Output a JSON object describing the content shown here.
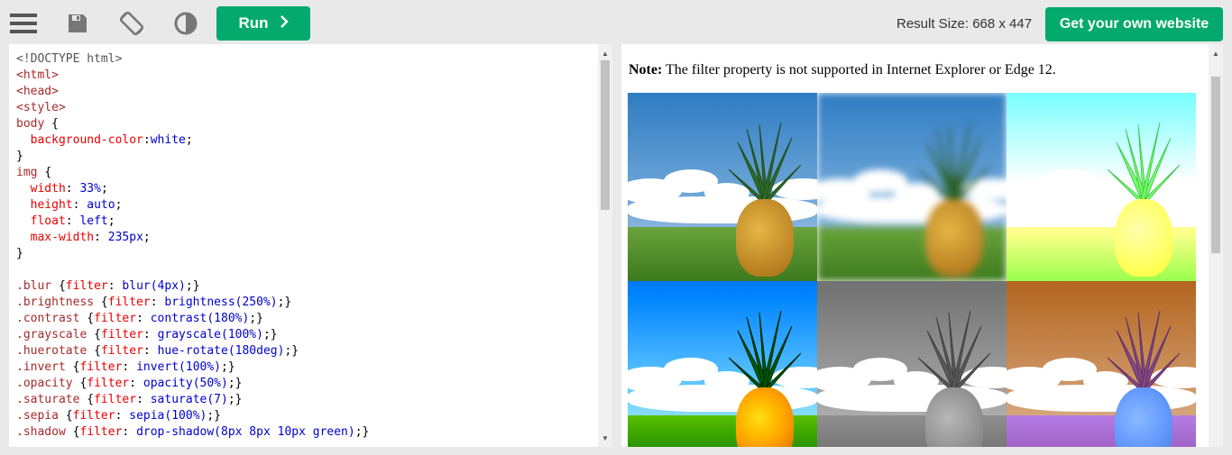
{
  "toolbar": {
    "menu_icon": "menu-icon",
    "save_icon": "save-icon",
    "rotate_icon": "rotate-icon",
    "theme_icon": "contrast-icon",
    "run_label": "Run",
    "result_size": "Result Size: 668 x 447",
    "get_website_label": "Get your own website"
  },
  "editor": {
    "lines": [
      "<!DOCTYPE html>",
      "<html>",
      "<head>",
      "<style>",
      "body {",
      "  background-color:white;",
      "}",
      "img {",
      "  width: 33%;",
      "  height: auto;",
      "  float: left;",
      "  max-width: 235px;",
      "}",
      "",
      ".blur {filter: blur(4px);}",
      ".brightness {filter: brightness(250%);}",
      ".contrast {filter: contrast(180%);}",
      ".grayscale {filter: grayscale(100%);}",
      ".huerotate {filter: hue-rotate(180deg);}",
      ".invert {filter: invert(100%);}",
      ".opacity {filter: opacity(50%);}",
      ".saturate {filter: saturate(7);}",
      ".sepia {filter: sepia(100%);}",
      ".shadow {filter: drop-shadow(8px 8px 10px green);}"
    ]
  },
  "result": {
    "note_label": "Note:",
    "note_text": " The filter property is not supported in Internet Explorer or Edge 12.",
    "images": [
      "none",
      "blur",
      "brightness",
      "contrast",
      "grayscale",
      "huerotate"
    ]
  }
}
